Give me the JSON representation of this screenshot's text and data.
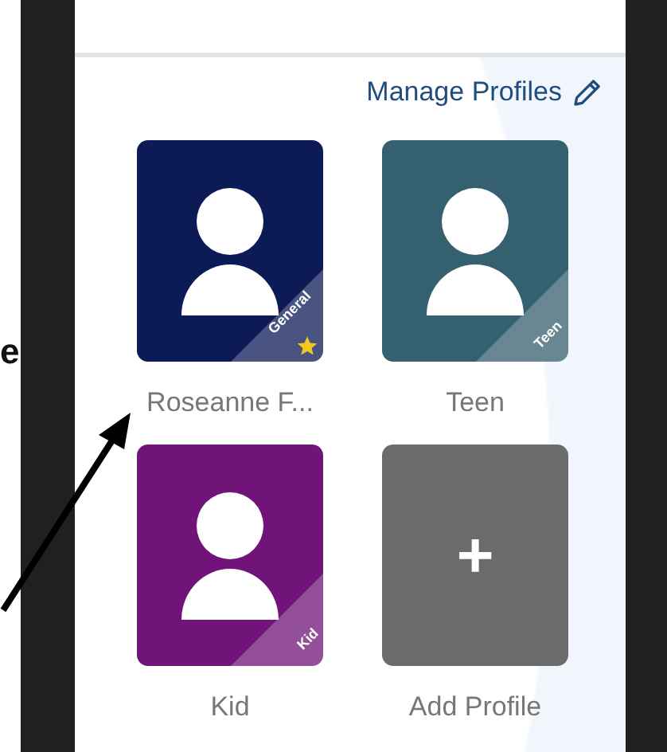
{
  "annotation": {
    "text": "e"
  },
  "manage_profiles": {
    "label": "Manage Profiles"
  },
  "profiles": [
    {
      "kind": "profile",
      "name": "Roseanne F...",
      "tag": "General",
      "color": "#0c1a55",
      "default": true
    },
    {
      "kind": "profile",
      "name": "Teen",
      "tag": "Teen",
      "color": "#35606f",
      "default": false
    },
    {
      "kind": "profile",
      "name": "Kid",
      "tag": "Kid",
      "color": "#71147a",
      "default": false
    },
    {
      "kind": "add",
      "name": "Add Profile",
      "symbol": "+"
    }
  ]
}
